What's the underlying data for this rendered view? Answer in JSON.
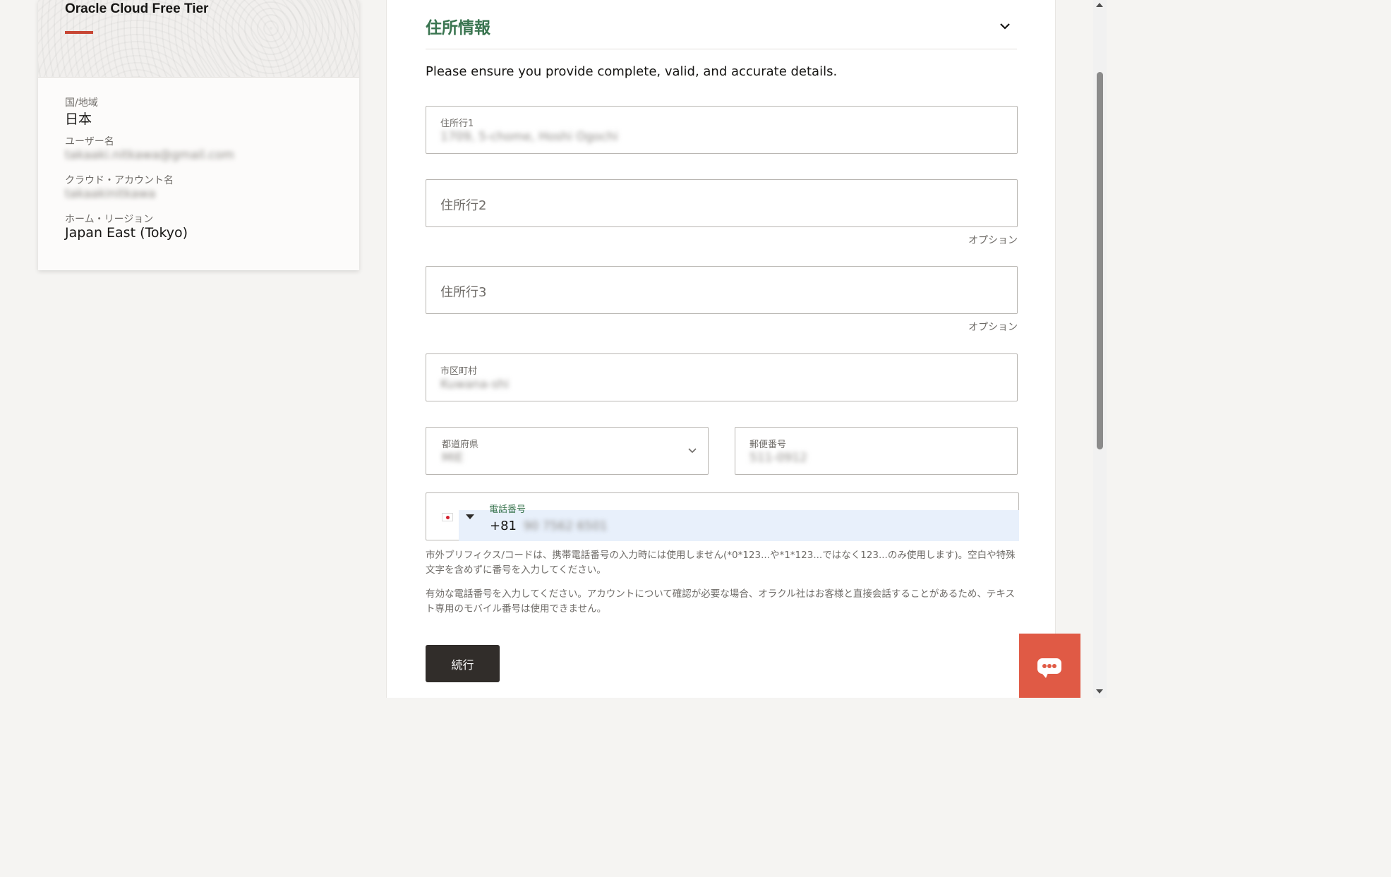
{
  "summary": {
    "title": "Oracle Cloud Free Tier",
    "country_label": "国/地域",
    "country_value": "日本",
    "username_label": "ユーザー名",
    "username_value": "takaaki.nitkawa@gmail.com",
    "cloud_account_label": "クラウド・アカウント名",
    "cloud_account_value": "takaakinitkawa",
    "home_region_label": "ホーム・リージョン",
    "home_region_value": "Japan East (Tokyo)"
  },
  "address": {
    "section_title": "住所情報",
    "notice": "Please ensure you provide complete, valid, and accurate details.",
    "line1_label": "住所行1",
    "line1_value": "1709, 5-chome, Hoshi Ogochi",
    "line2_placeholder": "住所行2",
    "line2_optional": "オプション",
    "line3_placeholder": "住所行3",
    "line3_optional": "オプション",
    "city_label": "市区町村",
    "city_value": "Kuwana-shi",
    "prefecture_label": "都道府県",
    "prefecture_value": "MIE",
    "postal_label": "郵便番号",
    "postal_value": "511-0912",
    "phone_label": "電話番号",
    "phone_prefix": "+81",
    "phone_value": "90 7562 6501",
    "phone_help_1": "市外プリフィクス/コードは、携帯電話番号の入力時には使用しません(*0*123...や*1*123...ではなく123...のみ使用します)。空白や特殊文字を含めずに番号を入力してください。",
    "phone_help_2": "有効な電話番号を入力してください。アカウントについて確認が必要な場合、オラクル社はお客様と直接会話することがあるため、テキスト専用のモバイル番号は使用できません。",
    "continue_label": "続行"
  },
  "colors": {
    "accent_red": "#c74634",
    "section_green": "#3a7550",
    "button_dark": "#312d2a",
    "chat_red": "#e05a45"
  },
  "icons": {
    "collapse": "chevron-down-icon",
    "prefecture_dropdown": "chevron-down-icon",
    "country_flag": "japan-flag-icon",
    "country_caret": "caret-down-icon",
    "chat": "chat-icon"
  }
}
